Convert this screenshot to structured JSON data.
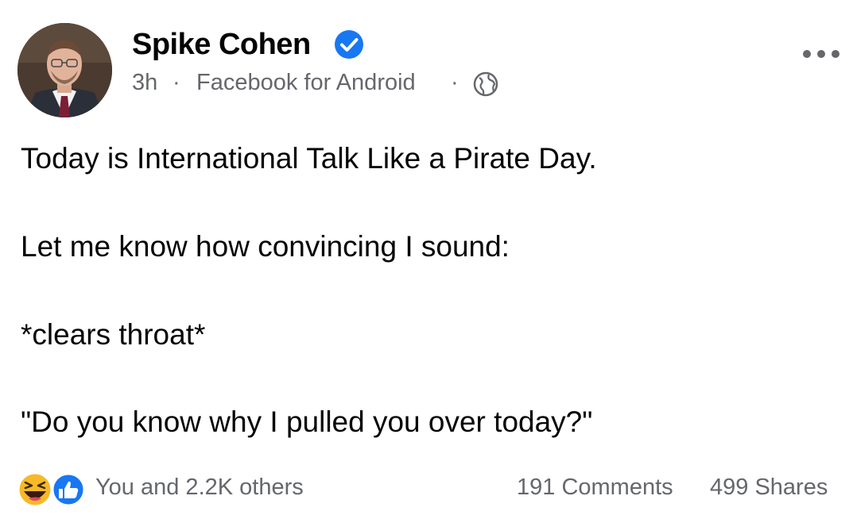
{
  "post": {
    "author": {
      "name": "Spike Cohen",
      "verified": true,
      "avatar_icon": "profile-photo"
    },
    "meta": {
      "time": "3h",
      "separator": "·",
      "source": "Facebook for Android",
      "audience_icon": "globe-icon"
    },
    "more_icon": "more-options-icon",
    "text_lines": [
      "Today is International Talk Like a Pirate Day.",
      "Let me know how convincing I sound:",
      "*clears throat*",
      "\"Do you know why I pulled you over today?\""
    ],
    "footer": {
      "reaction_icons": [
        "haha-icon",
        "like-icon"
      ],
      "reactions_text": "You and 2.2K others",
      "comments": "191 Comments",
      "shares": "499 Shares"
    },
    "colors": {
      "primary_text": "#050505",
      "secondary_text": "#65676b",
      "verified_blue": "#1877f2",
      "haha_yellow": "#f7b928"
    }
  }
}
